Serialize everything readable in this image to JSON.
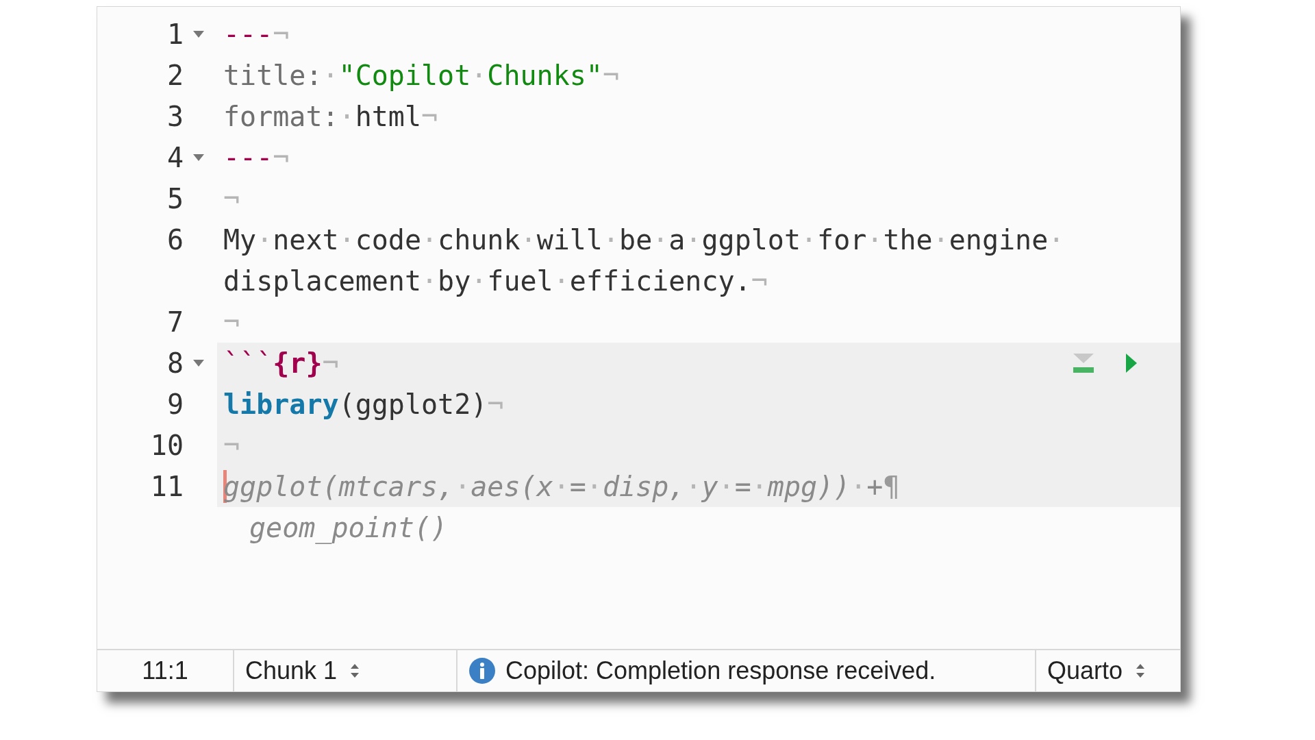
{
  "editor": {
    "lines": [
      {
        "number": "1",
        "foldable": true,
        "rows": [
          {
            "tokens": [
              {
                "kind": "fence",
                "text": "---"
              },
              {
                "kind": "ws",
                "text": "¬"
              }
            ]
          }
        ]
      },
      {
        "number": "2",
        "rows": [
          {
            "tokens": [
              {
                "kind": "key",
                "text": "title:"
              },
              {
                "kind": "ws",
                "text": "·"
              },
              {
                "kind": "string",
                "text": "\"Copilot"
              },
              {
                "kind": "ws",
                "text": "·"
              },
              {
                "kind": "string",
                "text": "Chunks\""
              },
              {
                "kind": "ws",
                "text": "¬"
              }
            ]
          }
        ]
      },
      {
        "number": "3",
        "rows": [
          {
            "tokens": [
              {
                "kind": "key",
                "text": "format:"
              },
              {
                "kind": "ws",
                "text": "·"
              },
              {
                "kind": "plain",
                "text": "html"
              },
              {
                "kind": "ws",
                "text": "¬"
              }
            ]
          }
        ]
      },
      {
        "number": "4",
        "foldable": true,
        "rows": [
          {
            "tokens": [
              {
                "kind": "fence",
                "text": "---"
              },
              {
                "kind": "ws",
                "text": "¬"
              }
            ]
          }
        ]
      },
      {
        "number": "5",
        "rows": [
          {
            "tokens": [
              {
                "kind": "ws",
                "text": "¬"
              }
            ]
          }
        ]
      },
      {
        "number": "6",
        "rows": [
          {
            "tokens": [
              {
                "kind": "plain",
                "text": "My"
              },
              {
                "kind": "ws",
                "text": "·"
              },
              {
                "kind": "plain",
                "text": "next"
              },
              {
                "kind": "ws",
                "text": "·"
              },
              {
                "kind": "plain",
                "text": "code"
              },
              {
                "kind": "ws",
                "text": "·"
              },
              {
                "kind": "plain",
                "text": "chunk"
              },
              {
                "kind": "ws",
                "text": "·"
              },
              {
                "kind": "plain",
                "text": "will"
              },
              {
                "kind": "ws",
                "text": "·"
              },
              {
                "kind": "plain",
                "text": "be"
              },
              {
                "kind": "ws",
                "text": "·"
              },
              {
                "kind": "plain",
                "text": "a"
              },
              {
                "kind": "ws",
                "text": "·"
              },
              {
                "kind": "plain",
                "text": "ggplot"
              },
              {
                "kind": "ws",
                "text": "·"
              },
              {
                "kind": "plain",
                "text": "for"
              },
              {
                "kind": "ws",
                "text": "·"
              },
              {
                "kind": "plain",
                "text": "the"
              },
              {
                "kind": "ws",
                "text": "·"
              },
              {
                "kind": "plain",
                "text": "engine"
              },
              {
                "kind": "ws",
                "text": "·"
              }
            ]
          },
          {
            "tokens": [
              {
                "kind": "plain",
                "text": "displacement"
              },
              {
                "kind": "ws",
                "text": "·"
              },
              {
                "kind": "plain",
                "text": "by"
              },
              {
                "kind": "ws",
                "text": "·"
              },
              {
                "kind": "plain",
                "text": "fuel"
              },
              {
                "kind": "ws",
                "text": "·"
              },
              {
                "kind": "plain",
                "text": "efficiency."
              },
              {
                "kind": "ws",
                "text": "¬"
              }
            ]
          }
        ]
      },
      {
        "number": "7",
        "rows": [
          {
            "tokens": [
              {
                "kind": "ws",
                "text": "¬"
              }
            ]
          }
        ]
      },
      {
        "number": "8",
        "foldable": true,
        "chunk_header": true,
        "rows": [
          {
            "chunk": true,
            "tokens": [
              {
                "kind": "fence",
                "text": "```"
              },
              {
                "kind": "chunk-label",
                "text": "{r}"
              },
              {
                "kind": "ws",
                "text": "¬"
              }
            ]
          }
        ]
      },
      {
        "number": "9",
        "rows": [
          {
            "chunk": true,
            "tokens": [
              {
                "kind": "keyword",
                "text": "library"
              },
              {
                "kind": "plain",
                "text": "(ggplot2)"
              },
              {
                "kind": "ws",
                "text": "¬"
              }
            ]
          }
        ]
      },
      {
        "number": "10",
        "rows": [
          {
            "chunk": true,
            "tokens": [
              {
                "kind": "ws",
                "text": "¬"
              }
            ]
          }
        ]
      },
      {
        "number": "11",
        "cursor": true,
        "rows": [
          {
            "chunk": true,
            "tokens": [
              {
                "kind": "ghost",
                "text": "ggplot(mtcars,"
              },
              {
                "kind": "ws",
                "text": "·"
              },
              {
                "kind": "ghost",
                "text": "aes(x"
              },
              {
                "kind": "ws",
                "text": "·"
              },
              {
                "kind": "ghost",
                "text": "="
              },
              {
                "kind": "ws",
                "text": "·"
              },
              {
                "kind": "ghost",
                "text": "disp,"
              },
              {
                "kind": "ws",
                "text": "·"
              },
              {
                "kind": "ghost",
                "text": "y"
              },
              {
                "kind": "ws",
                "text": "·"
              },
              {
                "kind": "ghost",
                "text": "="
              },
              {
                "kind": "ws",
                "text": "·"
              },
              {
                "kind": "ghost",
                "text": "mpg))"
              },
              {
                "kind": "ws",
                "text": "·"
              },
              {
                "kind": "ghost",
                "text": "+"
              },
              {
                "kind": "mark",
                "text": "¶"
              }
            ]
          },
          {
            "indented": true,
            "tokens": [
              {
                "kind": "ghost",
                "text": "geom_point()"
              }
            ]
          }
        ]
      }
    ]
  },
  "status_bar": {
    "position": "11:1",
    "chunk": "Chunk 1",
    "message": "Copilot: Completion response received.",
    "file_type": "Quarto"
  }
}
